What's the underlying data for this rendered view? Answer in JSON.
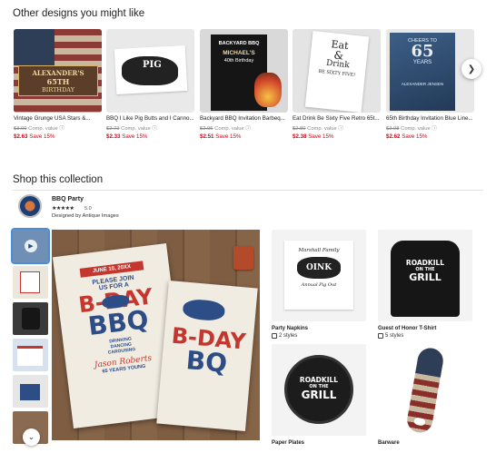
{
  "sections": {
    "recommendations_title": "Other designs you might like",
    "collection_title": "Shop this collection"
  },
  "recommendations": [
    {
      "name": "Vintage Grunge USA Stars &...",
      "orig_price": "$3.09",
      "comp_label": "Comp. value",
      "price": "$2.63",
      "save": "Save 15%",
      "img_text": [
        "ALEXANDER'S",
        "65TH",
        "BIRTHDAY"
      ]
    },
    {
      "name": "BBQ I Like Pig Butts and I Canno...",
      "orig_price": "$2.73",
      "comp_label": "Comp. value",
      "price": "$2.33",
      "save": "Save 15%",
      "img_text": [
        "PIG"
      ]
    },
    {
      "name": "Backyard BBQ Invitation Barbeq...",
      "orig_price": "$2.95",
      "comp_label": "Comp. value",
      "price": "$2.51",
      "save": "Save 15%",
      "img_text": [
        "BACKYARD BBQ",
        "MICHAEL'S",
        "40th Birthday"
      ]
    },
    {
      "name": "Eat Drink Be Sixty Five Retro 65t...",
      "orig_price": "$2.80",
      "comp_label": "Comp. value",
      "price": "$2.38",
      "save": "Save 15%",
      "img_text": [
        "Eat",
        "&",
        "Drink",
        "BE SIXTY FIVE!"
      ]
    },
    {
      "name": "65th Birthday Invitation Blue Line...",
      "orig_price": "$3.08",
      "comp_label": "Comp. value",
      "price": "$2.62",
      "save": "Save 15%",
      "img_text": [
        "CHEERS TO",
        "65",
        "YEARS",
        "ALEXANDER JENSEN"
      ]
    }
  ],
  "collection": {
    "name": "BBQ Party",
    "stars": "★★★★★",
    "rating": "5.0",
    "designer": "Designed by Antique Images"
  },
  "hero_text": {
    "date": "JUNE 10, 20XX",
    "invite": [
      "PLEASE JOIN",
      "US FOR A"
    ],
    "bday": "B-DAY",
    "bbq": "BBQ",
    "activities": [
      "DRINKING",
      "DANCING",
      "CAROUSING"
    ],
    "name": "Jason Roberts",
    "years": "65 YEARS YOUNG",
    "card2_bday": "B-DAY",
    "card2_bbq": "BQ"
  },
  "products": [
    {
      "title": "Party Napkins",
      "styles": "2 styles",
      "img_text": [
        "Marshall Family",
        "OINK",
        "Annual Pig Out"
      ]
    },
    {
      "title": "Guest of Honor T-Shirt",
      "styles": "5 styles",
      "img_text": [
        "ROADKILL",
        "ON THE",
        "GRILL"
      ]
    },
    {
      "title": "Paper Plates",
      "img_text": [
        "ROADKILL",
        "ON THE",
        "GRILL"
      ]
    },
    {
      "title": "Barware"
    }
  ],
  "colors": {
    "sale_red": "#d0021b",
    "accent_blue": "#4c8bd6",
    "bbq_blue": "#2d4d86",
    "bbq_red": "#c5372e"
  }
}
